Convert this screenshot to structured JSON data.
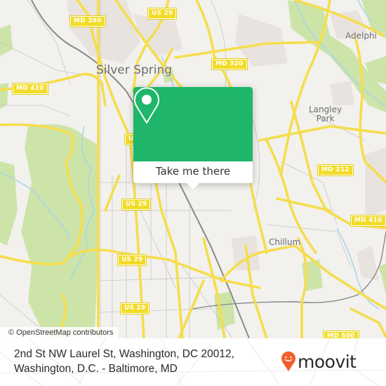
{
  "map": {
    "colors": {
      "background": "#f2f1ed",
      "park": "#cde4a9",
      "urban": "#e9e3df",
      "road_major": "#f5dd4d",
      "road_minor": "#c9c6c2",
      "water": "#a9d6e8",
      "rail": "#8a8a8a"
    },
    "place_labels": [
      {
        "id": "silver-spring",
        "label": "Silver Spring"
      },
      {
        "id": "adelphi",
        "label": "Adelphi"
      },
      {
        "id": "langley-park",
        "label": "Langley\nPark"
      },
      {
        "id": "chillum",
        "label": "Chillum"
      }
    ],
    "route_shields": [
      {
        "id": "md-390",
        "label": "MD 390"
      },
      {
        "id": "us-29-north",
        "label": "US 29"
      },
      {
        "id": "md-320",
        "label": "MD 320"
      },
      {
        "id": "md-410-west",
        "label": "MD 410"
      },
      {
        "id": "us-29-mid",
        "label": "U"
      },
      {
        "id": "us-29-center",
        "label": "US 29"
      },
      {
        "id": "md-212",
        "label": "MD 212"
      },
      {
        "id": "md-410-east",
        "label": "MD 410"
      },
      {
        "id": "us-29-south1",
        "label": "US 29"
      },
      {
        "id": "us-29-south2",
        "label": "US 29"
      },
      {
        "id": "md-500",
        "label": "MD 500"
      }
    ],
    "attribution": "© OpenStreetMap contributors"
  },
  "popup": {
    "icon": "map-pin-icon",
    "button_label": "Take me there",
    "accent_color": "#1fb56a"
  },
  "footer": {
    "address_line1": "2nd St NW Laurel St, Washington, DC 20012,",
    "address_line2": "Washington, D.C. - Baltimore, MD",
    "brand": {
      "name": "moovit",
      "icon": "moovit-smiley-pin-icon",
      "color": "#f15f2e"
    }
  }
}
